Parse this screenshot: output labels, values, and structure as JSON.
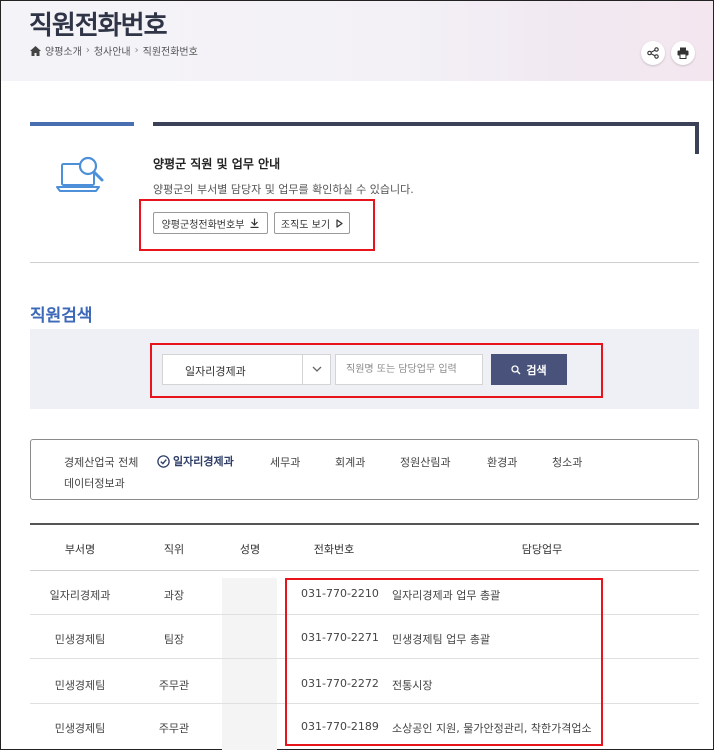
{
  "header": {
    "title": "직원전화번호",
    "breadcrumb": [
      "양평소개",
      "청사안내",
      "직원전화번호"
    ]
  },
  "info": {
    "title": "양평군 직원 및 업무 안내",
    "description": "양평군의 부서별 담당자 및 업무를 확인하실 수 있습니다.",
    "phonebook_button": "양평군청전화번호부",
    "org_button": "조직도 보기"
  },
  "search": {
    "section_title": "직원검색",
    "department_value": "일자리경제과",
    "input_placeholder": "직원명 또는 담당업무 입력",
    "button_label": "검색"
  },
  "tabs": [
    "경제산업국 전체",
    "일자리경제과",
    "세무과",
    "회계과",
    "정원산림과",
    "환경과",
    "청소과",
    "데이터정보과"
  ],
  "active_tab": "일자리경제과",
  "table": {
    "headers": [
      "부서명",
      "직위",
      "성명",
      "전화번호",
      "담당업무"
    ],
    "rows": [
      {
        "dept": "일자리경제과",
        "position": "과장",
        "name": "",
        "phone": "031-770-2210",
        "duty": "일자리경제과 업무 총괄"
      },
      {
        "dept": "민생경제팀",
        "position": "팀장",
        "name": "",
        "phone": "031-770-2271",
        "duty": "민생경제팀 업무 총괄"
      },
      {
        "dept": "민생경제팀",
        "position": "주무관",
        "name": "",
        "phone": "031-770-2272",
        "duty": "전통시장"
      },
      {
        "dept": "민생경제팀",
        "position": "주무관",
        "name": "",
        "phone": "031-770-2189",
        "duty": "소상공인 지원, 물가안정관리, 착한가격업소"
      }
    ]
  },
  "colors": {
    "accent_blue": "#3d6ab8",
    "dark_navy": "#48527a",
    "highlight_red": "#e8141b"
  }
}
